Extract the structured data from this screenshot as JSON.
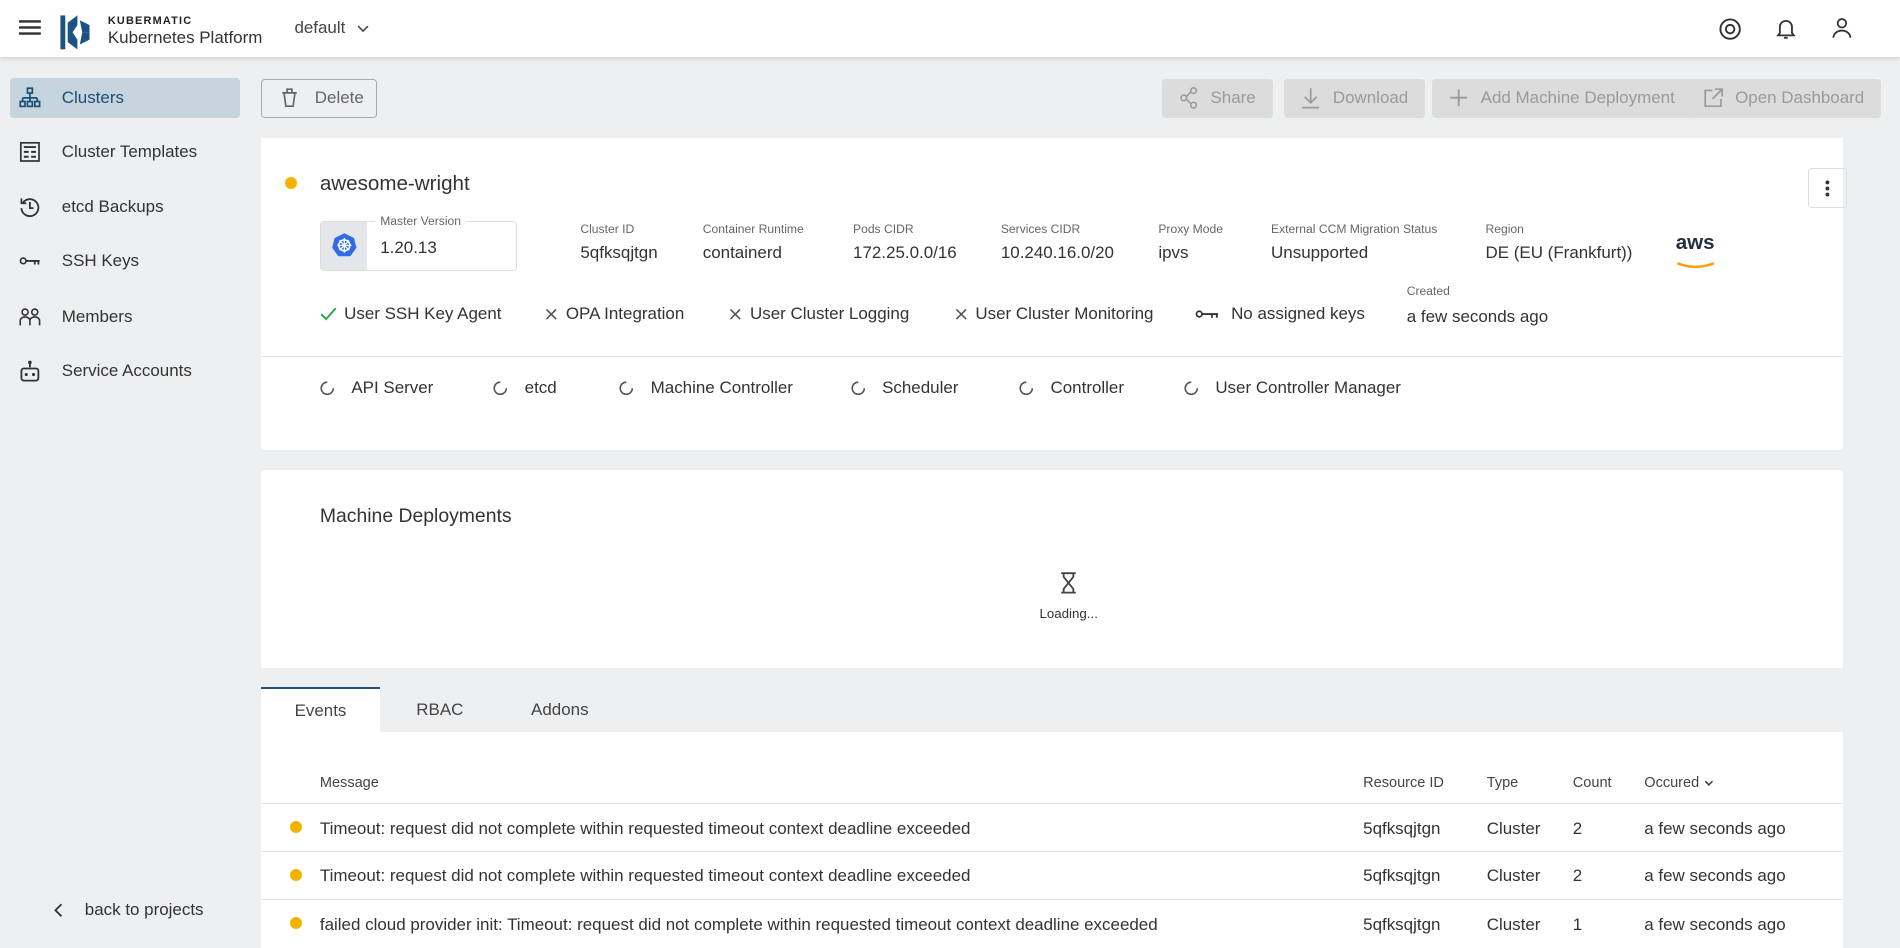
{
  "header": {
    "brand_top": "KUBERMATIC",
    "brand_bottom": "Kubernetes Platform",
    "project": "default"
  },
  "sidebar": {
    "items": [
      {
        "label": "Clusters",
        "icon": "sitemap-icon"
      },
      {
        "label": "Cluster Templates",
        "icon": "template-icon"
      },
      {
        "label": "etcd Backups",
        "icon": "history-icon"
      },
      {
        "label": "SSH Keys",
        "icon": "key-icon"
      },
      {
        "label": "Members",
        "icon": "members-icon"
      },
      {
        "label": "Service Accounts",
        "icon": "robot-icon"
      }
    ],
    "back": "back to projects"
  },
  "toolbar": {
    "delete": "Delete",
    "share": "Share",
    "download": "Download",
    "add_md": "Add Machine Deployment",
    "open_dashboard": "Open Dashboard"
  },
  "cluster": {
    "name": "awesome-wright",
    "status_color": "#f5b300",
    "master_version_label": "Master Version",
    "master_version": "1.20.13",
    "fields": [
      {
        "label": "Cluster ID",
        "value": "5qfksqjtgn"
      },
      {
        "label": "Container Runtime",
        "value": "containerd"
      },
      {
        "label": "Pods CIDR",
        "value": "172.25.0.0/16"
      },
      {
        "label": "Services CIDR",
        "value": "10.240.16.0/20"
      },
      {
        "label": "Proxy Mode",
        "value": "ipvs"
      },
      {
        "label": "External CCM Migration Status",
        "value": "Unsupported"
      },
      {
        "label": "Region",
        "value": "DE (EU (Frankfurt))"
      }
    ],
    "provider": "aws",
    "features": [
      {
        "label": "User SSH Key Agent",
        "enabled": true
      },
      {
        "label": "OPA Integration",
        "enabled": false
      },
      {
        "label": "User Cluster Logging",
        "enabled": false
      },
      {
        "label": "User Cluster Monitoring",
        "enabled": false
      }
    ],
    "keys": "No assigned keys",
    "created_label": "Created",
    "created": "a few seconds ago",
    "health": [
      "API Server",
      "etcd",
      "Machine Controller",
      "Scheduler",
      "Controller",
      "User Controller Manager"
    ]
  },
  "machine_deployments": {
    "title": "Machine Deployments",
    "loading": "Loading..."
  },
  "tabs": [
    "Events",
    "RBAC",
    "Addons"
  ],
  "events": {
    "columns": [
      "Message",
      "Resource ID",
      "Type",
      "Count",
      "Occured"
    ],
    "rows": [
      {
        "message": "Timeout: request did not complete within requested timeout context deadline exceeded",
        "resource": "5qfksqjtgn",
        "type": "Cluster",
        "count": "2",
        "occurred": "a few seconds ago"
      },
      {
        "message": "Timeout: request did not complete within requested timeout context deadline exceeded",
        "resource": "5qfksqjtgn",
        "type": "Cluster",
        "count": "2",
        "occurred": "a few seconds ago"
      },
      {
        "message": "failed cloud provider init: Timeout: request did not complete within requested timeout context deadline exceeded",
        "resource": "5qfksqjtgn",
        "type": "Cluster",
        "count": "1",
        "occurred": "a few seconds ago"
      }
    ]
  }
}
